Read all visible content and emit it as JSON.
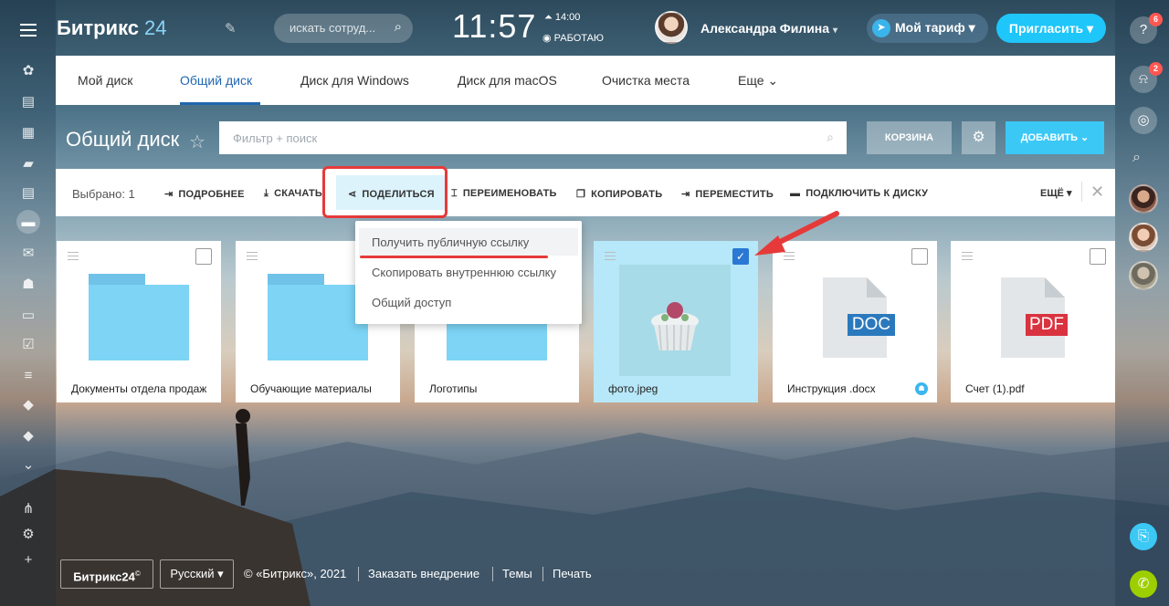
{
  "header": {
    "logo_text": "Битрикс",
    "logo_num": "24",
    "search_placeholder": "искать сотруд...",
    "clock": "11:57",
    "alarm_time": "14:00",
    "work_status": "РАБОТАЮ",
    "user_name": "Александра Филина",
    "user_caret": "▾",
    "tariff_label": "Мой тариф ▾",
    "invite_label": "Пригласить ▾"
  },
  "right_bar": {
    "help_badge": "6",
    "notif_badge": "2"
  },
  "tabs": [
    {
      "label": "Мой диск"
    },
    {
      "label": "Общий диск"
    },
    {
      "label": "Диск для Windows"
    },
    {
      "label": "Диск для macOS"
    },
    {
      "label": "Очистка места"
    },
    {
      "label": "Еще ⌄"
    }
  ],
  "page": {
    "title": "Общий диск",
    "filter_placeholder": "Фильтр + поиск",
    "trash_label": "КОРЗИНА",
    "add_label": "ДОБАВИТЬ ⌄"
  },
  "action_bar": {
    "selected": "Выбрано: 1",
    "actions": [
      {
        "label": "ПОДРОБНЕЕ",
        "icon": "⇥"
      },
      {
        "label": "СКАЧАТЬ",
        "icon": "⤓"
      },
      {
        "label": "ПОДЕЛИТЬСЯ",
        "icon": "⋖"
      },
      {
        "label": "ПЕРЕИМЕНОВАТЬ",
        "icon": "⌶"
      },
      {
        "label": "КОПИРОВАТЬ",
        "icon": "❐"
      },
      {
        "label": "ПЕРЕМЕСТИТЬ",
        "icon": "⇥"
      },
      {
        "label": "ПОДКЛЮЧИТЬ К ДИСКУ",
        "icon": "▬"
      }
    ],
    "more_label": "ЕЩЁ ▾"
  },
  "share_menu": {
    "items": [
      {
        "label": "Получить публичную ссылку"
      },
      {
        "label": "Скопировать внутреннюю ссылку"
      },
      {
        "label": "Общий доступ"
      }
    ]
  },
  "files": [
    {
      "name": "Документы отдела продаж",
      "kind": "folder",
      "selected": false
    },
    {
      "name": "Обучающие материалы",
      "kind": "folder",
      "selected": false
    },
    {
      "name": "Логотипы",
      "kind": "folder",
      "selected": false
    },
    {
      "name": "фото.jpeg",
      "kind": "image",
      "selected": true
    },
    {
      "name": "Инструкция .docx",
      "kind": "doc",
      "tag": "DOC",
      "tag_color": "#2b79bd",
      "selected": false
    },
    {
      "name": "Счет (1).pdf",
      "kind": "pdf",
      "tag": "PDF",
      "tag_color": "#d9333f",
      "selected": false
    }
  ],
  "footer": {
    "brand": "Битрикс24",
    "brand_mark": "©",
    "language": "Русский ▾",
    "copyright": "© «Битрикс», 2021",
    "links": [
      "Заказать внедрение",
      "Темы",
      "Печать"
    ]
  },
  "colors": {
    "accent": "#2067b0",
    "primary_button": "#3bc8f5",
    "highlight_red": "#e63a3a"
  }
}
